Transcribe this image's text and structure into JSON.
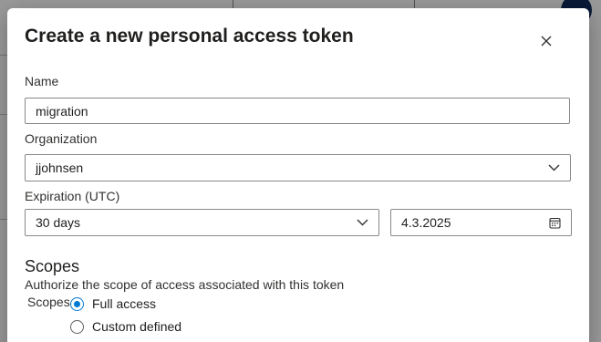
{
  "dialog": {
    "title": "Create a new personal access token",
    "close_icon": "close-icon"
  },
  "fields": {
    "name": {
      "label": "Name",
      "value": "migration"
    },
    "organization": {
      "label": "Organization",
      "value": "jjohnsen"
    },
    "expiration": {
      "label": "Expiration (UTC)",
      "duration": "30 days",
      "date": "4.3.2025",
      "calendar_icon": "calendar-icon"
    }
  },
  "scopes": {
    "title": "Scopes",
    "description": "Authorize the scope of access associated with this token",
    "label": "Scopes",
    "options": [
      {
        "label": "Full access",
        "selected": true
      },
      {
        "label": "Custom defined",
        "selected": false
      }
    ]
  },
  "colors": {
    "accent": "#0078d4",
    "border": "#8a8886",
    "text": "#201f1e",
    "avatar": "#0f2a5c"
  }
}
